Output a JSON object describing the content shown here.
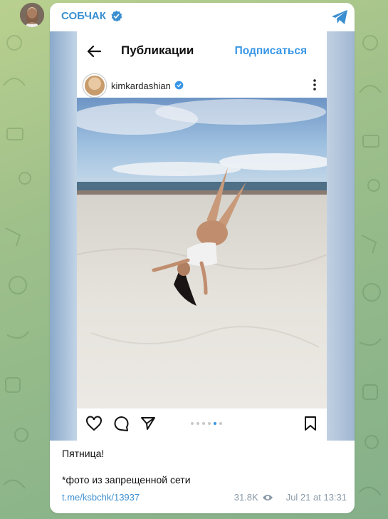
{
  "channel": {
    "name": "СОБЧАК",
    "avatar_icon": "user-avatar",
    "share_icon": "telegram-share-icon",
    "accent_color": "#3a8fd0"
  },
  "instagram": {
    "header_title": "Публикации",
    "follow_label": "Подписаться",
    "username": "kimkardashian",
    "back_icon": "arrow-left-icon",
    "more_icon": "more-vertical-icon",
    "actions": [
      "heart-icon",
      "comment-icon",
      "send-icon",
      "bookmark-icon"
    ],
    "carousel": {
      "count": 6,
      "active_index": 4
    },
    "accent_color": "#3896e6"
  },
  "post": {
    "caption": "Пятница!",
    "note": "*фото из запрещенной сети",
    "link": "t.me/ksbchk/13937",
    "views": "31.8K",
    "timestamp": "Jul 21 at 13:31"
  }
}
